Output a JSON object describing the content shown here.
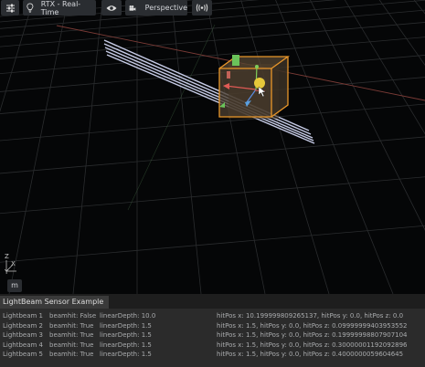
{
  "toolbar": {
    "settings_icon": "sliders-icon",
    "render_mode_icon": "lightbulb-icon",
    "render_mode_label": "RTX - Real-Time",
    "visibility_icon": "eye-icon",
    "camera_icon": "movie-camera-icon",
    "camera_label": "Perspective",
    "audio_icon": "audio-wave-icon"
  },
  "viewport": {
    "axis_labels": [
      "Z",
      "X",
      "Y"
    ],
    "unit_chip": "m",
    "selection_color": "#e8962a",
    "gizmo_colors": {
      "x": "#e05a55",
      "y": "#7fce5a",
      "z": "#5a8de0",
      "center": "#e6c83a"
    }
  },
  "panel": {
    "title": "LightBeam Sensor Example",
    "rows": [
      {
        "name": "Lightbeam 1",
        "hit": "beamhit: False",
        "depth": "linearDepth: 10.0",
        "pos": "hitPos x: 10.199999809265137, hitPos y: 0.0, hitPos z: 0.0"
      },
      {
        "name": "Lightbeam 2",
        "hit": "beamhit: True",
        "depth": "linearDepth: 1.5",
        "pos": "hitPos x: 1.5, hitPos y: 0.0, hitPos z: 0.09999999403953552"
      },
      {
        "name": "Lightbeam 3",
        "hit": "beamhit: True",
        "depth": "linearDepth: 1.5",
        "pos": "hitPos x: 1.5, hitPos y: 0.0, hitPos z: 0.19999998807907104"
      },
      {
        "name": "Lightbeam 4",
        "hit": "beamhit: True",
        "depth": "linearDepth: 1.5",
        "pos": "hitPos x: 1.5, hitPos y: 0.0, hitPos z: 0.30000001192092896"
      },
      {
        "name": "Lightbeam 5",
        "hit": "beamhit: True",
        "depth": "linearDepth: 1.5",
        "pos": "hitPos x: 1.5, hitPos y: 0.0, hitPos z: 0.4000000059604645"
      }
    ]
  }
}
